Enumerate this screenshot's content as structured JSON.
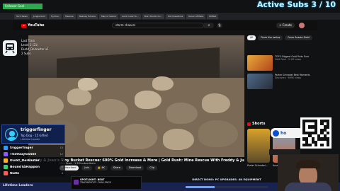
{
  "overlay": {
    "alert_text": "Follower Goal",
    "active_subs_label": "Active Subs",
    "active_subs_value": "3 / 10"
  },
  "browser": {
    "tabs": [
      "Tech News",
      "Jungle Gold",
      "Hydrau.",
      "Hisense",
      "Nasdaq Futures",
      "Map of Sailors",
      "Gold Coast Fa...",
      "Start Studio Co...",
      "Poll Questions",
      "Karen Affiliate",
      "RMNet"
    ]
  },
  "youtube": {
    "logo_text": "YouTube",
    "search_value": "storm chasers",
    "search_icon": "search-icon",
    "mic_icon": "mic-icon",
    "create_label": "+ Create",
    "video_title": "Freddy & Juan's Tiny Bucket Rescue: 600% Gold Increase & More | Gold Rush: Mine Rescue With Freddy & Juan",
    "channel_line": "Gold Rush · 1.2M subscribers",
    "actions": {
      "subscribe": "Subscribed",
      "join": "Join",
      "like": "👍 4K",
      "share": "Share",
      "download": "Download",
      "clip": "Clip"
    }
  },
  "sidebar": {
    "chips": [
      "All",
      "From the series",
      "From Aussie Gold"
    ],
    "recommendations": [
      {
        "title": "TOP 5 Biggest Gold Finds Ever",
        "meta": "Gold Rush · 2.1M views"
      },
      {
        "title": "Parker Schnabel Best Moments",
        "meta": "Discovery · 890K views"
      }
    ],
    "shorts_label": "Shorts",
    "shorts": [
      {
        "caption": "Parker Schnabel..."
      },
      {
        "caption": "Aussie miner..."
      }
    ]
  },
  "train": {
    "lines": [
      "Last Train",
      "Level 1 (21)",
      "Durkt_Derkaster x1",
      "2 Subs"
    ]
  },
  "top_supporter": {
    "name": "triggerfinger",
    "subtitle": "Top Dog - 15 Gifted",
    "role": "Lifetime Leader"
  },
  "leaderboard": {
    "title": "Lifetime Leaders",
    "rows": [
      {
        "name": "triggerfinger",
        "value": "15",
        "color": "#2e9bff"
      },
      {
        "name": "ThatGuyGamie",
        "value": "12",
        "color": "#8a5cff"
      },
      {
        "name": "Durkt_Derkaster",
        "value": "9",
        "color": "#ffb21c"
      },
      {
        "name": "BoundTAHappon",
        "value": "6",
        "color": "#3ccf6e"
      },
      {
        "name": "Nullo",
        "value": "4",
        "color": "#ff5b5b"
      }
    ]
  },
  "ticker": {
    "line1": "SPOTLIGHT: BEAT",
    "line2": "TRADINGPOST: CHALLENGE"
  },
  "goal": {
    "text": "DIRECT DONO: PC UPGRADES: 4K EQUIPMENT",
    "progress": 0.35
  },
  "sponsor": {
    "text": "ho"
  },
  "colors": {
    "accent": "#ff0000",
    "overlay_blue": "#10204c",
    "subs_glow": "#00aaff"
  }
}
